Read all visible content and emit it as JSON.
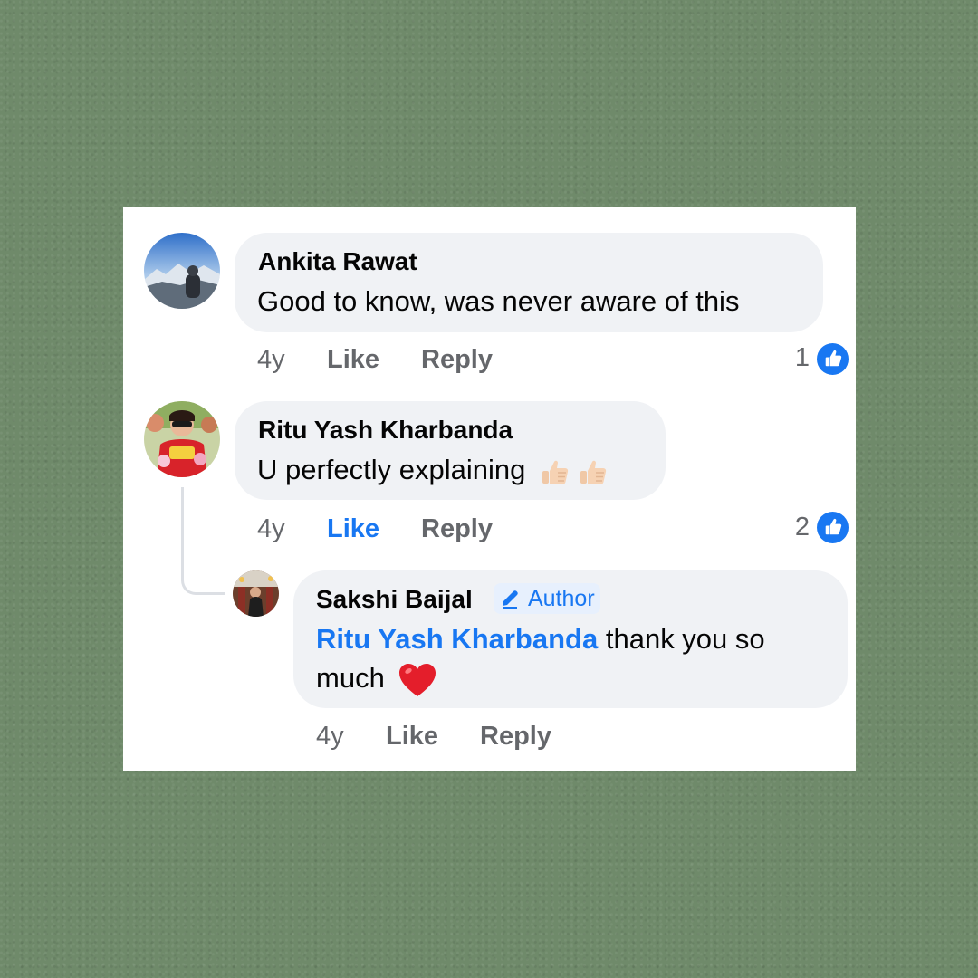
{
  "comments": [
    {
      "author": "Ankita Rawat",
      "text": "Good to know, was never aware of this",
      "time": "4y",
      "like_label": "Like",
      "reply_label": "Reply",
      "reaction_count": "1"
    },
    {
      "author": "Ritu Yash Kharbanda",
      "text": "U perfectly explaining",
      "emojis": [
        "thumbs-up-light-skin",
        "thumbs-up-light-skin"
      ],
      "time": "4y",
      "like_label": "Like",
      "like_active": true,
      "reply_label": "Reply",
      "reaction_count": "2"
    }
  ],
  "reply": {
    "author": "Sakshi Baijal",
    "badge": "Author",
    "mention": "Ritu Yash Kharbanda",
    "text_line1": "thank you so",
    "text_line2": "much",
    "emoji": "red-heart",
    "time": "4y",
    "like_label": "Like",
    "reply_label": "Reply"
  },
  "colors": {
    "background": "#6f8a6a",
    "bubble": "#f0f2f5",
    "accent": "#1877f2",
    "meta": "#65676b"
  }
}
